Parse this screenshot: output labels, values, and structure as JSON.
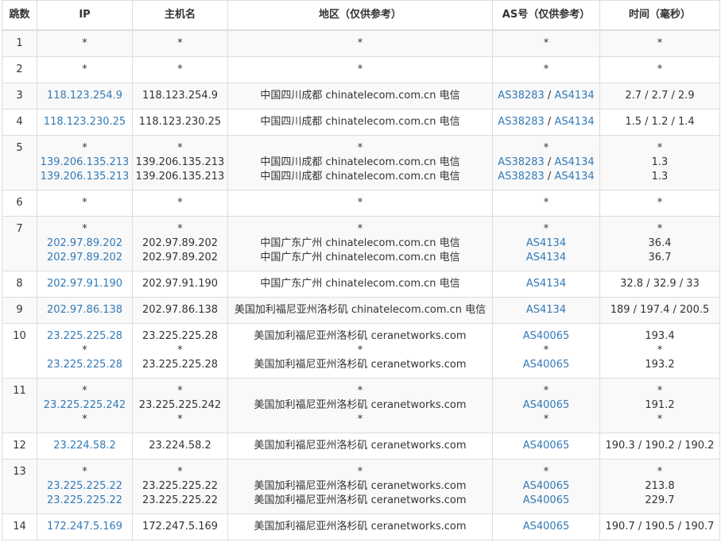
{
  "headers": {
    "hop": "跳数",
    "ip": "IP",
    "host": "主机名",
    "region": "地区（仅供参考）",
    "as": "AS号（仅供参考）",
    "time": "时间（毫秒）"
  },
  "rows": [
    {
      "hop": "1",
      "lines": [
        {
          "ip": "*",
          "host": "*",
          "region": "*",
          "as": [
            "*"
          ],
          "time": "*"
        }
      ]
    },
    {
      "hop": "2",
      "lines": [
        {
          "ip": "*",
          "host": "*",
          "region": "*",
          "as": [
            "*"
          ],
          "time": "*"
        }
      ]
    },
    {
      "hop": "3",
      "lines": [
        {
          "ip": "118.123.254.9",
          "host": "118.123.254.9",
          "region": "中国四川成都 chinatelecom.com.cn 电信",
          "as": [
            "AS38283",
            "AS4134"
          ],
          "time": "2.7 / 2.7 / 2.9"
        }
      ]
    },
    {
      "hop": "4",
      "lines": [
        {
          "ip": "118.123.230.25",
          "host": "118.123.230.25",
          "region": "中国四川成都 chinatelecom.com.cn 电信",
          "as": [
            "AS38283",
            "AS4134"
          ],
          "time": "1.5 / 1.2 / 1.4"
        }
      ]
    },
    {
      "hop": "5",
      "lines": [
        {
          "ip": "*",
          "host": "*",
          "region": "*",
          "as": [
            "*"
          ],
          "time": "*"
        },
        {
          "ip": "139.206.135.213",
          "host": "139.206.135.213",
          "region": "中国四川成都 chinatelecom.com.cn 电信",
          "as": [
            "AS38283",
            "AS4134"
          ],
          "time": "1.3"
        },
        {
          "ip": "139.206.135.213",
          "host": "139.206.135.213",
          "region": "中国四川成都 chinatelecom.com.cn 电信",
          "as": [
            "AS38283",
            "AS4134"
          ],
          "time": "1.3"
        }
      ]
    },
    {
      "hop": "6",
      "lines": [
        {
          "ip": "*",
          "host": "*",
          "region": "*",
          "as": [
            "*"
          ],
          "time": "*"
        }
      ]
    },
    {
      "hop": "7",
      "lines": [
        {
          "ip": "*",
          "host": "*",
          "region": "*",
          "as": [
            "*"
          ],
          "time": "*"
        },
        {
          "ip": "202.97.89.202",
          "host": "202.97.89.202",
          "region": "中国广东广州 chinatelecom.com.cn 电信",
          "as": [
            "AS4134"
          ],
          "time": "36.4"
        },
        {
          "ip": "202.97.89.202",
          "host": "202.97.89.202",
          "region": "中国广东广州 chinatelecom.com.cn 电信",
          "as": [
            "AS4134"
          ],
          "time": "36.7"
        }
      ]
    },
    {
      "hop": "8",
      "lines": [
        {
          "ip": "202.97.91.190",
          "host": "202.97.91.190",
          "region": "中国广东广州 chinatelecom.com.cn 电信",
          "as": [
            "AS4134"
          ],
          "time": "32.8 / 32.9 / 33"
        }
      ]
    },
    {
      "hop": "9",
      "lines": [
        {
          "ip": "202.97.86.138",
          "host": "202.97.86.138",
          "region": "美国加利福尼亚州洛杉矶 chinatelecom.com.cn 电信",
          "as": [
            "AS4134"
          ],
          "time": "189 / 197.4 / 200.5"
        }
      ]
    },
    {
      "hop": "10",
      "lines": [
        {
          "ip": "23.225.225.28",
          "host": "23.225.225.28",
          "region": "美国加利福尼亚州洛杉矶 ceranetworks.com",
          "as": [
            "AS40065"
          ],
          "time": "193.4"
        },
        {
          "ip": "*",
          "host": "*",
          "region": "*",
          "as": [
            "*"
          ],
          "time": "*"
        },
        {
          "ip": "23.225.225.28",
          "host": "23.225.225.28",
          "region": "美国加利福尼亚州洛杉矶 ceranetworks.com",
          "as": [
            "AS40065"
          ],
          "time": "193.2"
        }
      ]
    },
    {
      "hop": "11",
      "lines": [
        {
          "ip": "*",
          "host": "*",
          "region": "*",
          "as": [
            "*"
          ],
          "time": "*"
        },
        {
          "ip": "23.225.225.242",
          "host": "23.225.225.242",
          "region": "美国加利福尼亚州洛杉矶 ceranetworks.com",
          "as": [
            "AS40065"
          ],
          "time": "191.2"
        },
        {
          "ip": "*",
          "host": "*",
          "region": "*",
          "as": [
            "*"
          ],
          "time": "*"
        }
      ]
    },
    {
      "hop": "12",
      "lines": [
        {
          "ip": "23.224.58.2",
          "host": "23.224.58.2",
          "region": "美国加利福尼亚州洛杉矶 ceranetworks.com",
          "as": [
            "AS40065"
          ],
          "time": "190.3 / 190.2 / 190.2"
        }
      ]
    },
    {
      "hop": "13",
      "lines": [
        {
          "ip": "*",
          "host": "*",
          "region": "*",
          "as": [
            "*"
          ],
          "time": "*"
        },
        {
          "ip": "23.225.225.22",
          "host": "23.225.225.22",
          "region": "美国加利福尼亚州洛杉矶 ceranetworks.com",
          "as": [
            "AS40065"
          ],
          "time": "213.8"
        },
        {
          "ip": "23.225.225.22",
          "host": "23.225.225.22",
          "region": "美国加利福尼亚州洛杉矶 ceranetworks.com",
          "as": [
            "AS40065"
          ],
          "time": "229.7"
        }
      ]
    },
    {
      "hop": "14",
      "lines": [
        {
          "ip": "172.247.5.169",
          "host": "172.247.5.169",
          "region": "美国加利福尼亚州洛杉矶 ceranetworks.com",
          "as": [
            "AS40065"
          ],
          "time": "190.7 / 190.5 / 190.7"
        }
      ]
    }
  ],
  "colors": {
    "link": "#337ab7",
    "text": "#333333",
    "border": "#dddddd",
    "stripe": "#f9f9f9"
  }
}
